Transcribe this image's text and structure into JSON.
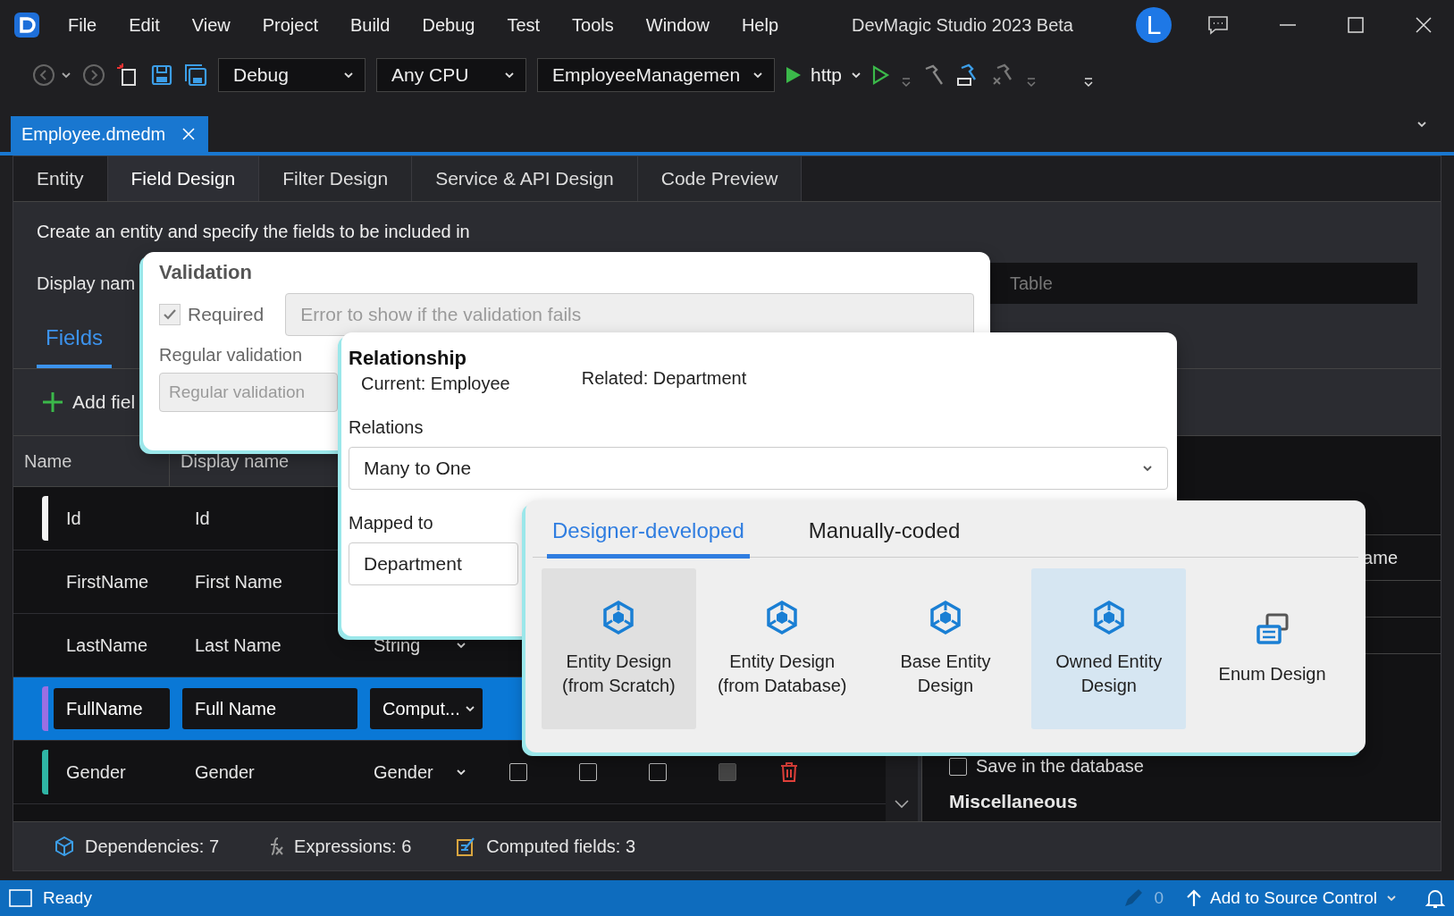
{
  "window": {
    "title": "DevMagic Studio 2023 Beta",
    "avatar": "L"
  },
  "menu": [
    "File",
    "Edit",
    "View",
    "Project",
    "Build",
    "Debug",
    "Test",
    "Tools",
    "Window",
    "Help"
  ],
  "toolbar": {
    "dropdowns": [
      "Debug",
      "Any CPU",
      "EmployeeManagemen"
    ],
    "run_target": "http"
  },
  "document_tabs": [
    {
      "label": "Employee.dmedm",
      "selected": true
    }
  ],
  "designer_tabs": [
    {
      "label": "Entity",
      "selected": false
    },
    {
      "label": "Field Design",
      "selected": true
    },
    {
      "label": "Filter Design",
      "selected": false
    },
    {
      "label": "Service & API Design",
      "selected": false
    },
    {
      "label": "Code Preview",
      "selected": false
    }
  ],
  "intro": "Create an entity and specify the fields to be included in",
  "display_name_label": "Display nam",
  "table_name_placeholder": "Table",
  "section_tabs": [
    {
      "label": "Fields",
      "selected": true
    }
  ],
  "add_field": "Add fiel",
  "fields_table": {
    "columns": [
      "Name",
      "Display name"
    ],
    "rows": [
      {
        "name": "Id",
        "display_name": "Id",
        "selected": false,
        "color": "#f2f2f2"
      },
      {
        "name": "FirstName",
        "display_name": "First Name",
        "selected": false
      },
      {
        "name": "LastName",
        "display_name": "Last Name",
        "type": "String",
        "selected": false
      },
      {
        "name": "FullName",
        "display_name": "Full Name",
        "type": "Comput...",
        "selected": true,
        "color": "#9b6fe3"
      },
      {
        "name": "Gender",
        "display_name": "Gender",
        "type": "Gender",
        "selected": false,
        "color": "#2fb5a5",
        "checks": [
          {
            "checked": false,
            "disabled": false
          },
          {
            "checked": false,
            "disabled": false
          },
          {
            "checked": false,
            "disabled": false
          },
          {
            "checked": false,
            "disabled": true
          }
        ]
      }
    ]
  },
  "right_panel": {
    "column_fragment": "ame",
    "save_in_database": {
      "label": "Save in the database",
      "checked": false
    },
    "section": "Miscellaneous"
  },
  "summary": [
    {
      "kind": "dependencies",
      "label": "Dependencies: 7"
    },
    {
      "kind": "expressions",
      "label": "Expressions: 6"
    },
    {
      "kind": "computed",
      "label": "Computed fields: 3"
    }
  ],
  "status_bar": {
    "status": "Ready",
    "pending_count": "0",
    "source_control": "Add to Source Control"
  },
  "validation_card": {
    "title": "Validation",
    "required": {
      "label": "Required",
      "checked": true
    },
    "error_placeholder": "Error to show if the validation fails",
    "regex_label": "Regular validation",
    "regex_placeholder": "Regular validation"
  },
  "relationship_card": {
    "title": "Relationship",
    "current": "Current: Employee",
    "related": "Related: Department",
    "relations_label": "Relations",
    "relations_value": "Many to One",
    "mapped_label": "Mapped to",
    "mapped_value": "Department"
  },
  "designer_card": {
    "tabs": [
      {
        "label": "Designer-developed",
        "selected": true
      },
      {
        "label": "Manually-coded",
        "selected": false
      }
    ],
    "items": [
      {
        "kind": "entity",
        "label": "Entity Design (from Scratch)",
        "selected": false,
        "hovered": true
      },
      {
        "kind": "entity",
        "label": "Entity Design (from Database)",
        "selected": false,
        "hovered": false
      },
      {
        "kind": "entity",
        "label": "Base Entity Design",
        "selected": false,
        "hovered": false
      },
      {
        "kind": "entity",
        "label": "Owned Entity Design",
        "selected": true,
        "hovered": false
      },
      {
        "kind": "enum",
        "label": "Enum Design",
        "selected": false,
        "hovered": false
      }
    ]
  }
}
